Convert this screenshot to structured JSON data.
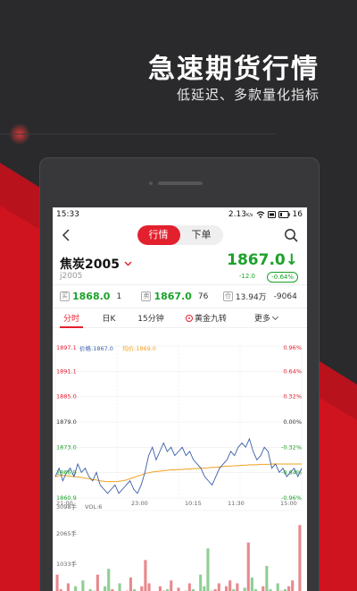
{
  "promo": {
    "title": "急速期货行情",
    "subtitle": "低延迟、多款量化指标"
  },
  "status": {
    "time": "15:33",
    "speed": "2.13",
    "speed_unit": "K/s",
    "battery": "16"
  },
  "nav": {
    "tab_quote": "行情",
    "tab_order": "下单"
  },
  "quote": {
    "name": "焦炭2005",
    "code": "j2005",
    "price": "1867.0",
    "arrow": "↓",
    "change": "-12.0",
    "pct": "-0.64%"
  },
  "bidask": {
    "buy_tag": "买",
    "buy_price": "1868.0",
    "buy_vol": "1",
    "sell_tag": "卖",
    "sell_price": "1867.0",
    "sell_vol": "76",
    "hold_tag": "仓",
    "volume": "13.94万",
    "hold_change": "-9064"
  },
  "tabs": [
    "分时",
    "日K",
    "15分钟",
    "黄金九转",
    "更多"
  ],
  "colors": {
    "accent": "#e3202e",
    "down": "#1ba22a",
    "price_line": "#3a5fa8",
    "avg_line": "#f0a020"
  },
  "chart_data": {
    "type": "line",
    "legend": {
      "price": "价格:1867.0",
      "avg": "均价:1869.0"
    },
    "y_left_labels": [
      "1897.1",
      "1891.1",
      "1885.0",
      "1879.0",
      "1873.0",
      "1866.9",
      "1860.9"
    ],
    "y_right_labels": [
      "0.96%",
      "0.64%",
      "0.32%",
      "0.00%",
      "-0.32%",
      "-0.64%",
      "-0.96%"
    ],
    "ylim": [
      1860.9,
      1897.1
    ],
    "x_labels": [
      "21:00",
      "23:00",
      "10:15",
      "11:30",
      "15:00"
    ],
    "volume_labels": [
      "3098手",
      "VOL:6",
      "2065手",
      "1033手"
    ],
    "series": [
      {
        "key": "price",
        "values": [
          1866,
          1868,
          1865,
          1867,
          1868,
          1866,
          1869,
          1867,
          1868,
          1866,
          1865,
          1867,
          1864,
          1863,
          1862,
          1863,
          1864,
          1862,
          1863,
          1864,
          1865,
          1863,
          1862,
          1864,
          1867,
          1871,
          1873,
          1870,
          1872,
          1874,
          1872,
          1873,
          1871,
          1872,
          1873,
          1871,
          1872,
          1870,
          1869,
          1868,
          1866,
          1865,
          1864,
          1866,
          1868,
          1869,
          1870,
          1872,
          1871,
          1873,
          1874,
          1873,
          1875,
          1872,
          1870,
          1871,
          1873,
          1872,
          1868,
          1869,
          1867,
          1868,
          1866,
          1867,
          1868,
          1866,
          1868
        ]
      },
      {
        "key": "avg",
        "values": [
          1866,
          1866.2,
          1866.3,
          1866.2,
          1866.1,
          1866,
          1865.9,
          1865.8,
          1865.6,
          1865.5,
          1865.3,
          1865.2,
          1865,
          1864.9,
          1864.8,
          1864.8,
          1864.8,
          1864.9,
          1865,
          1865.2,
          1865.5,
          1865.8,
          1866.1,
          1866.4,
          1866.7,
          1866.9,
          1867.1,
          1867.2,
          1867.3,
          1867.4,
          1867.5,
          1867.6,
          1867.6,
          1867.7,
          1867.7,
          1867.8,
          1867.8,
          1867.9,
          1867.9,
          1868,
          1868,
          1868.1,
          1868.2,
          1868.2,
          1868.3,
          1868.4,
          1868.5,
          1868.5,
          1868.6,
          1868.6,
          1868.7,
          1868.7,
          1868.8,
          1868.8,
          1868.8,
          1868.9,
          1868.9,
          1868.9,
          1869,
          1869,
          1869,
          1869,
          1869,
          1869,
          1869,
          1869,
          1869
        ]
      },
      {
        "key": "volume",
        "values": [
          900,
          400,
          300,
          600,
          200,
          500,
          300,
          700,
          250,
          400,
          350,
          900,
          300,
          500,
          1100,
          400,
          300,
          600,
          200,
          350,
          800,
          400,
          300,
          500,
          1400,
          600,
          300,
          250,
          500,
          350,
          400,
          700,
          300,
          450,
          250,
          350,
          600,
          400,
          300,
          900,
          500,
          1800,
          350,
          400,
          600,
          300,
          500,
          700,
          400,
          600,
          300,
          450,
          2000,
          800,
          400,
          300,
          500,
          1200,
          400,
          300,
          600,
          350,
          400,
          500,
          700,
          300,
          2600
        ]
      }
    ]
  }
}
